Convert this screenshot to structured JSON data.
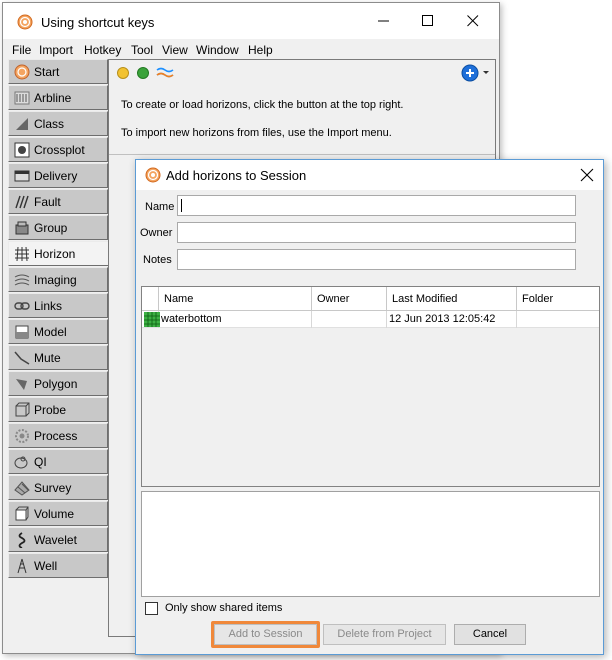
{
  "window": {
    "title": "Using shortcut keys",
    "menu": [
      "File",
      "Import",
      "Hotkey",
      "Tool",
      "View",
      "Window",
      "Help"
    ]
  },
  "sidebar": {
    "items": [
      {
        "label": "Start",
        "icon": "start-icon"
      },
      {
        "label": "Arbline",
        "icon": "arbline-icon"
      },
      {
        "label": "Class",
        "icon": "class-icon"
      },
      {
        "label": "Crossplot",
        "icon": "crossplot-icon"
      },
      {
        "label": "Delivery",
        "icon": "delivery-icon"
      },
      {
        "label": "Fault",
        "icon": "fault-icon"
      },
      {
        "label": "Group",
        "icon": "group-icon"
      },
      {
        "label": "Horizon",
        "icon": "horizon-icon",
        "active": true
      },
      {
        "label": "Imaging",
        "icon": "imaging-icon"
      },
      {
        "label": "Links",
        "icon": "links-icon"
      },
      {
        "label": "Model",
        "icon": "model-icon"
      },
      {
        "label": "Mute",
        "icon": "mute-icon"
      },
      {
        "label": "Polygon",
        "icon": "polygon-icon"
      },
      {
        "label": "Probe",
        "icon": "probe-icon"
      },
      {
        "label": "Process",
        "icon": "process-icon"
      },
      {
        "label": "QI",
        "icon": "qi-icon"
      },
      {
        "label": "Survey",
        "icon": "survey-icon"
      },
      {
        "label": "Volume",
        "icon": "volume-icon"
      },
      {
        "label": "Wavelet",
        "icon": "wavelet-icon"
      },
      {
        "label": "Well",
        "icon": "well-icon"
      }
    ]
  },
  "content": {
    "line1": "To create or load horizons, click the button at the top right.",
    "line2": "To import new horizons from files, use the Import menu."
  },
  "dialog": {
    "title": "Add horizons to Session",
    "fields": {
      "name_label": "Name",
      "owner_label": "Owner",
      "notes_label": "Notes",
      "name_value": "",
      "owner_value": "",
      "notes_value": ""
    },
    "table": {
      "columns": [
        "Name",
        "Owner",
        "Last Modified",
        "Folder"
      ],
      "rows": [
        {
          "name": "waterbottom",
          "owner": "",
          "modified": "12 Jun 2013 12:05:42",
          "folder": ""
        }
      ]
    },
    "checkbox_label": "Only show shared items",
    "checkbox_checked": false,
    "buttons": {
      "add": "Add to Session",
      "delete": "Delete from Project",
      "cancel": "Cancel"
    }
  },
  "colors": {
    "highlight": "#f0883a",
    "dialog_border": "#5b9bd5",
    "accent_blue": "#1e6fd9"
  }
}
